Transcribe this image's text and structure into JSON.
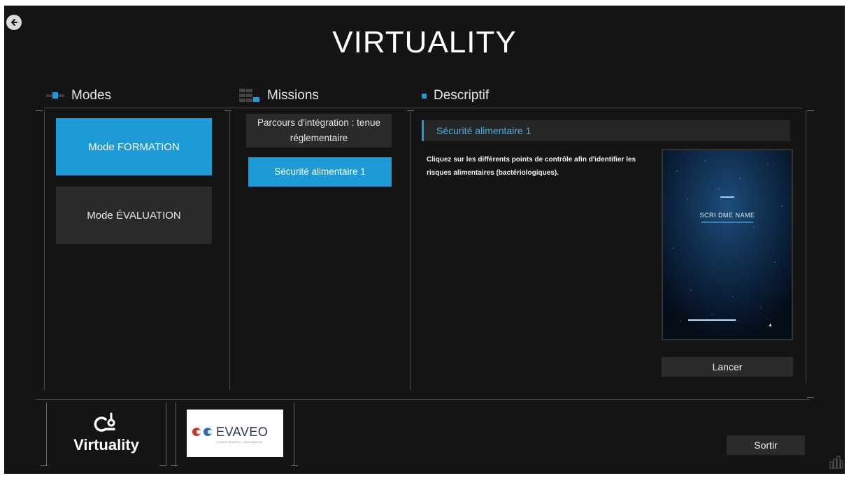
{
  "app": {
    "title": "VIRTUALITY"
  },
  "sections": {
    "modes": "Modes",
    "missions": "Missions",
    "descriptif": "Descriptif"
  },
  "modes": [
    {
      "label": "Mode FORMATION",
      "active": true
    },
    {
      "label": "Mode ÉVALUATION",
      "active": false
    }
  ],
  "missions": [
    {
      "label": "Parcours d'intégration : tenue réglementaire",
      "active": false
    },
    {
      "label": "Sécurité alimentaire 1",
      "active": true
    }
  ],
  "description": {
    "title": "Sécurité alimentaire 1",
    "text": "Cliquez sur les différents points de contrôle afin d'identifier les risques alimentaires (bactériologiques).",
    "preview_caption": "SCRI DME NAME",
    "launch_label": "Lancer"
  },
  "footer": {
    "logo_virtuality": "Virtuality",
    "logo_evaveo": "EVAVEO",
    "logo_evaveo_tagline": "COMPETENCES • INNOVATION",
    "exit_label": "Sortir"
  },
  "colors": {
    "accent": "#1e9ad6",
    "background": "#141414",
    "panel": "#2a2a2a"
  },
  "icons": [
    "back-arrow-icon",
    "modes-icon",
    "missions-icon",
    "descriptif-icon",
    "stats-icon"
  ]
}
